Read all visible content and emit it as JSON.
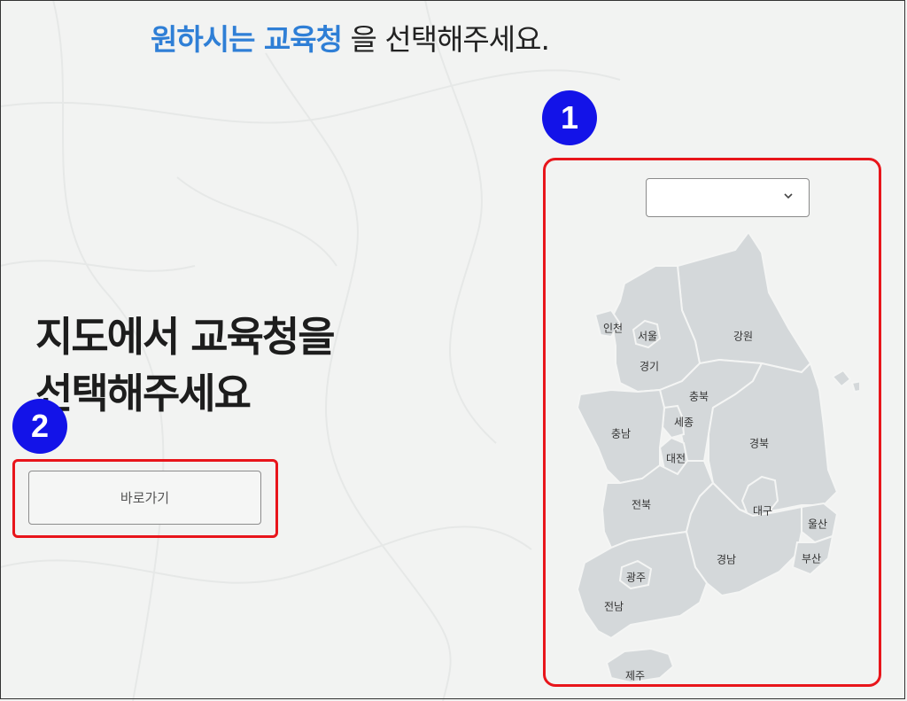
{
  "header": {
    "highlight": "원하시는 교육청",
    "rest": " 을 선택해주세요."
  },
  "main": {
    "heading_line1": "지도에서 교육청을",
    "heading_line2": "선택해주세요",
    "go_button_label": "바로가기"
  },
  "select": {
    "selected_value": ""
  },
  "badges": {
    "one": "1",
    "two": "2"
  },
  "map": {
    "regions": [
      "인천",
      "서울",
      "경기",
      "강원",
      "충북",
      "세종",
      "충남",
      "대전",
      "경북",
      "전북",
      "대구",
      "울산",
      "경남",
      "부산",
      "광주",
      "전남",
      "제주"
    ]
  },
  "colors": {
    "accent": "#2f7fd6",
    "badge": "#1313e8",
    "highlight_border": "#e8151b",
    "map_fill": "#d4d8da",
    "background": "#f2f3f2"
  }
}
